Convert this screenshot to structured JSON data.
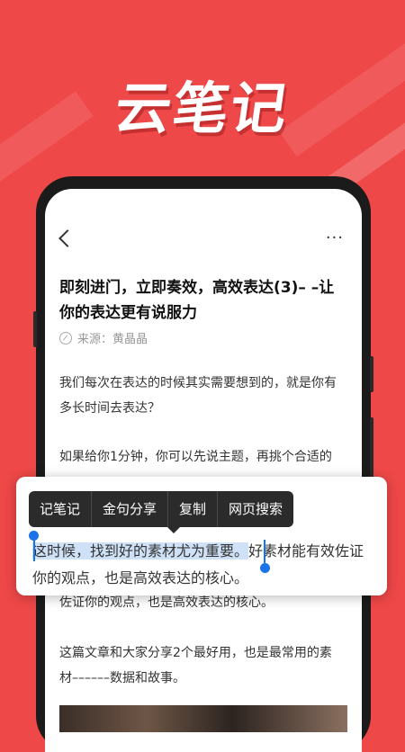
{
  "headline": "云笔记",
  "article": {
    "title": "即刻进门，立即奏效，高效表达(3)– –让你的表达更有说服力",
    "source_label": "来源：黄晶晶",
    "paragraphs": [
      "我们每次在表达的时候其实需要想到的，就是你有多长时间去表达？",
      "如果给你1分钟，你可以先说主题，再挑个合适的",
      "佐证你的观点，也是高效表达的核心。",
      "这篇文章和大家分享2个最好用，也是最常用的素材––––––数据和故事。"
    ]
  },
  "selection_toolbar": {
    "items": [
      "记笔记",
      "金句分享",
      "复制",
      "网页搜索"
    ]
  },
  "selection_popup": {
    "selected_text": "这时候，找到好的素材尤为重要。",
    "rest_text": "好素材能有效佐证你的观点，也是高效表达的核心。"
  },
  "colors": {
    "background": "#ef4848",
    "selection_highlight": "#cfe1f7",
    "handle": "#1a73e8"
  }
}
